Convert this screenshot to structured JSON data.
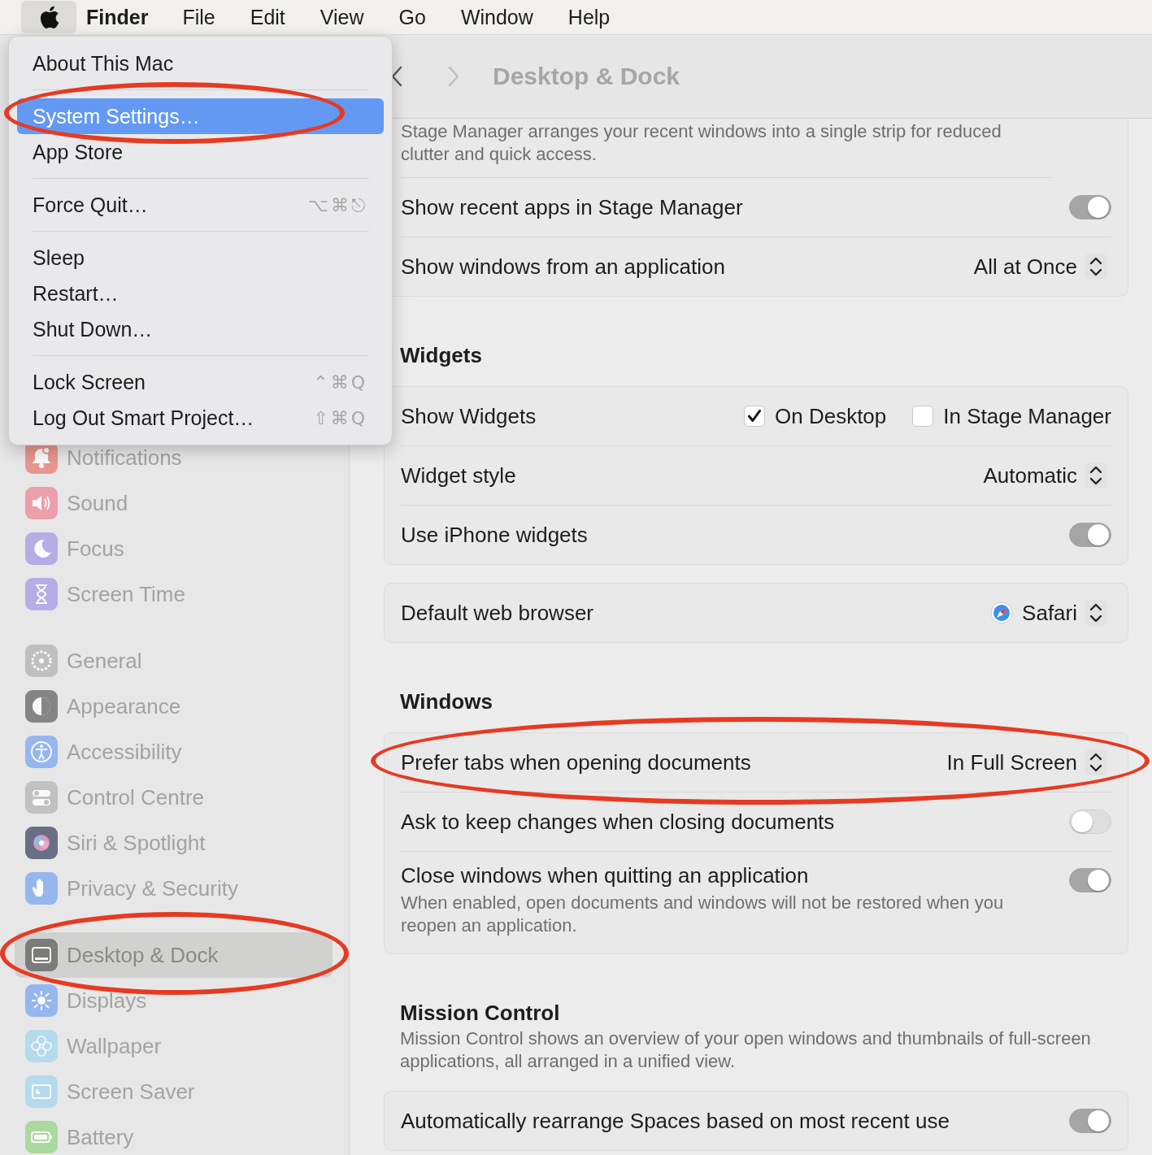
{
  "menu_bar": {
    "apple_selected": true,
    "items": [
      {
        "label": "Finder",
        "kind": "app"
      },
      {
        "label": "File",
        "kind": "menu"
      },
      {
        "label": "Edit",
        "kind": "menu"
      },
      {
        "label": "View",
        "kind": "menu"
      },
      {
        "label": "Go",
        "kind": "menu"
      },
      {
        "label": "Window",
        "kind": "menu"
      },
      {
        "label": "Help",
        "kind": "menu"
      }
    ]
  },
  "apple_menu": {
    "items": [
      {
        "kind": "item",
        "label": "About This Mac",
        "selected": false,
        "circled": false
      },
      {
        "kind": "separator"
      },
      {
        "kind": "item",
        "label": "System Settings…",
        "selected": true,
        "circled": true
      },
      {
        "kind": "item",
        "label": "App Store",
        "selected": false,
        "circled": false
      },
      {
        "kind": "separator"
      },
      {
        "kind": "item",
        "label": "Force Quit…",
        "shortcut": "⌥⌘⎋",
        "selected": false,
        "circled": false
      },
      {
        "kind": "separator"
      },
      {
        "kind": "item",
        "label": "Sleep",
        "selected": false,
        "circled": false
      },
      {
        "kind": "item",
        "label": "Restart…",
        "selected": false,
        "circled": false
      },
      {
        "kind": "item",
        "label": "Shut Down…",
        "selected": false,
        "circled": false
      },
      {
        "kind": "separator"
      },
      {
        "kind": "item",
        "label": "Lock Screen",
        "shortcut": "⌃⌘Q",
        "selected": false,
        "circled": false
      },
      {
        "kind": "item",
        "label": "Log Out Smart Project…",
        "shortcut": "⇧⌘Q",
        "selected": false,
        "circled": false
      }
    ]
  },
  "window": {
    "title": "Desktop & Dock",
    "back_disabled": false,
    "forward_disabled": true
  },
  "sidebar": {
    "groups": [
      {
        "items": [
          {
            "label": "Notifications",
            "selected": false,
            "circled": false
          },
          {
            "label": "Sound",
            "selected": false,
            "circled": false
          },
          {
            "label": "Focus",
            "selected": false,
            "circled": false
          },
          {
            "label": "Screen Time",
            "selected": false,
            "circled": false
          }
        ]
      },
      {
        "items": [
          {
            "label": "General",
            "selected": false,
            "circled": false
          },
          {
            "label": "Appearance",
            "selected": false,
            "circled": false
          },
          {
            "label": "Accessibility",
            "selected": false,
            "circled": false
          },
          {
            "label": "Control Centre",
            "selected": false,
            "circled": false
          },
          {
            "label": "Siri & Spotlight",
            "selected": false,
            "circled": false
          },
          {
            "label": "Privacy & Security",
            "selected": false,
            "circled": false
          }
        ]
      },
      {
        "items": [
          {
            "label": "Desktop & Dock",
            "selected": true,
            "circled": true
          },
          {
            "label": "Displays",
            "selected": false,
            "circled": false
          },
          {
            "label": "Wallpaper",
            "selected": false,
            "circled": false
          },
          {
            "label": "Screen Saver",
            "selected": false,
            "circled": false
          },
          {
            "label": "Battery",
            "selected": false,
            "circled": false
          }
        ]
      }
    ]
  },
  "content": [
    {
      "kind": "card",
      "rows": [
        {
          "kind": "note",
          "text": "Stage Manager arranges your recent windows into a single strip for reduced clutter and quick access."
        },
        {
          "kind": "toggle",
          "label": "Show recent apps in Stage Manager",
          "on": true,
          "circled": false
        },
        {
          "kind": "popup",
          "label": "Show windows from an application",
          "value": "All at Once",
          "circled": false
        }
      ]
    },
    {
      "kind": "heading",
      "text": "Widgets"
    },
    {
      "kind": "card",
      "rows": [
        {
          "kind": "checkboxes",
          "label": "Show Widgets",
          "circled": false,
          "options": [
            {
              "label": "On Desktop",
              "checked": true
            },
            {
              "label": "In Stage Manager",
              "checked": false
            }
          ]
        },
        {
          "kind": "popup",
          "label": "Widget style",
          "value": "Automatic",
          "circled": false
        },
        {
          "kind": "toggle",
          "label": "Use iPhone widgets",
          "on": true,
          "circled": false
        }
      ]
    },
    {
      "kind": "card",
      "rows": [
        {
          "kind": "app_popup",
          "label": "Default web browser",
          "value": "Safari",
          "circled": false
        }
      ]
    },
    {
      "kind": "heading",
      "text": "Windows"
    },
    {
      "kind": "card",
      "rows": [
        {
          "kind": "popup",
          "label": "Prefer tabs when opening documents",
          "value": "In Full Screen",
          "circled": true
        },
        {
          "kind": "toggle",
          "label": "Ask to keep changes when closing documents",
          "on": false,
          "circled": false
        },
        {
          "kind": "toggle",
          "label": "Close windows when quitting an application",
          "on": true,
          "circled": false,
          "description": "When enabled, open documents and windows will not be restored when you reopen an application."
        }
      ]
    },
    {
      "kind": "heading",
      "text": "Mission Control",
      "description": "Mission Control shows an overview of your open windows and thumbnails of full-screen applications, all arranged in a unified view."
    },
    {
      "kind": "card",
      "rows": [
        {
          "kind": "toggle",
          "label": "Automatically rearrange Spaces based on most recent use",
          "on": true,
          "circled": false
        }
      ]
    }
  ]
}
